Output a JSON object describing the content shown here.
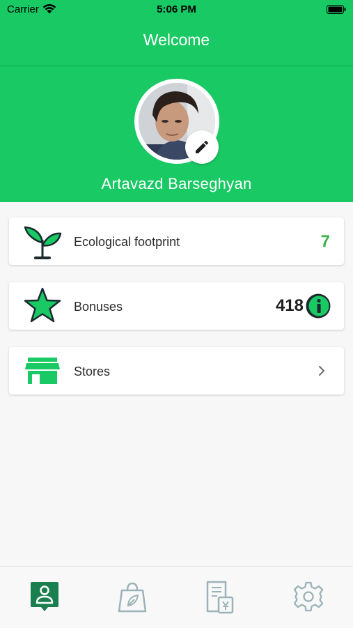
{
  "status_bar": {
    "carrier": "Carrier",
    "time": "5:06 PM"
  },
  "nav": {
    "title": "Welcome"
  },
  "profile": {
    "name": "Artavazd Barseghyan"
  },
  "cards": {
    "ecological": {
      "label": "Ecological footprint",
      "value": "7",
      "icon": "sprout-icon"
    },
    "bonuses": {
      "label": "Bonuses",
      "value": "418",
      "icon": "star-icon"
    },
    "stores": {
      "label": "Stores",
      "icon": "storefront-icon"
    }
  },
  "tabbar": {
    "items": [
      {
        "icon": "profile-icon",
        "selected": true
      },
      {
        "icon": "eco-bag-icon",
        "selected": false
      },
      {
        "icon": "receipt-icon",
        "selected": false
      },
      {
        "icon": "gear-icon",
        "selected": false
      }
    ]
  },
  "colors": {
    "brand_green": "#18c964",
    "value_green": "#3bb24a",
    "active_tab": "#1a7f4e",
    "inactive_tab": "#9bb3b8"
  }
}
